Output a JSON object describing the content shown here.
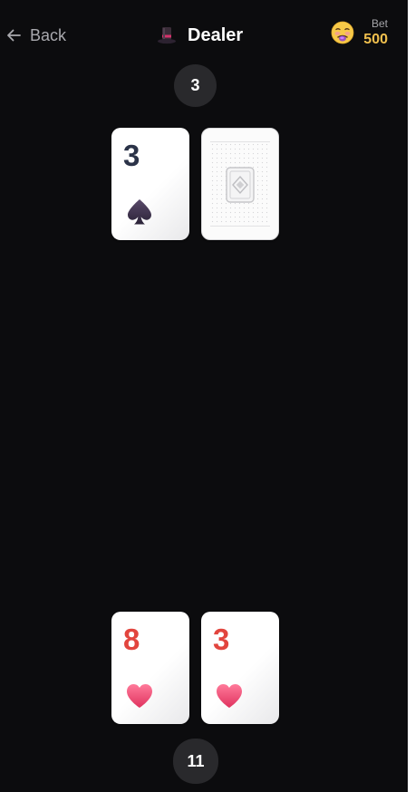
{
  "header": {
    "back_label": "Back",
    "back_icon": "arrow-left-icon",
    "title": "Dealer",
    "title_icon": "top-hat-icon",
    "bet_label": "Bet",
    "bet_amount": "500",
    "player_icon": "dizzy-face-emoji-icon"
  },
  "dealer": {
    "score": "3",
    "cards": [
      {
        "rank": "3",
        "suit": "spades",
        "face_up": true
      },
      {
        "rank": "",
        "suit": "",
        "face_up": false
      }
    ]
  },
  "player": {
    "score": "11",
    "cards": [
      {
        "rank": "8",
        "suit": "hearts",
        "face_up": true
      },
      {
        "rank": "3",
        "suit": "hearts",
        "face_up": true
      }
    ]
  },
  "colors": {
    "background": "#0c0c0e",
    "score_pill": "#29292c",
    "bet_amount": "#f2c14e",
    "red_suit": "#e2453e",
    "black_suit": "#2b3348"
  }
}
